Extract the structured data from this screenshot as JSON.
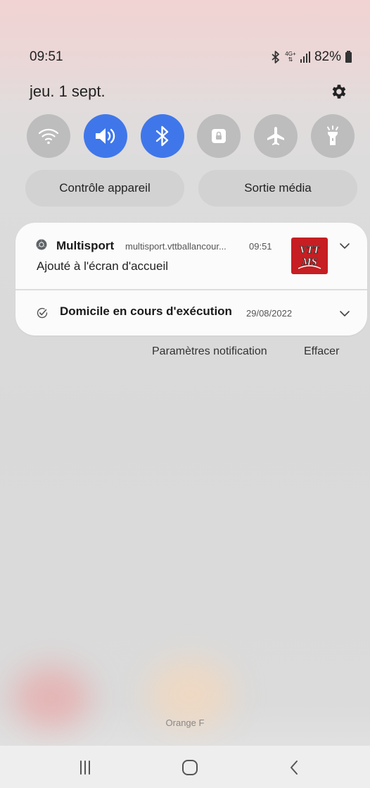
{
  "status_bar": {
    "time": "09:51",
    "network": "4G+",
    "battery": "82%",
    "icons": [
      "bluetooth-icon",
      "network-4g-icon",
      "signal-icon",
      "battery-icon"
    ]
  },
  "header": {
    "date": "jeu. 1 sept.",
    "settings_icon": "gear-icon"
  },
  "quick_settings": [
    {
      "name": "wifi",
      "icon": "wifi-icon",
      "active": false
    },
    {
      "name": "sound",
      "icon": "speaker-icon",
      "active": true
    },
    {
      "name": "bluetooth",
      "icon": "bluetooth-icon",
      "active": true
    },
    {
      "name": "rotation-lock",
      "icon": "lock-icon",
      "active": false
    },
    {
      "name": "airplane-mode",
      "icon": "airplane-icon",
      "active": false
    },
    {
      "name": "flashlight",
      "icon": "flashlight-icon",
      "active": false
    }
  ],
  "buttons": {
    "device_control": "Contrôle appareil",
    "media_output": "Sortie média"
  },
  "notifications": [
    {
      "app": "Multisport",
      "source": "multisport.vttballancour...",
      "time": "09:51",
      "body": "Ajouté à l'écran d'accueil",
      "icon": "chrome-icon",
      "thumbnail_text": "VTT MS"
    },
    {
      "title": "Domicile en cours d'exécution",
      "date": "29/08/2022",
      "icon": "check-circle-icon"
    }
  ],
  "notification_actions": {
    "settings": "Paramètres notification",
    "clear": "Effacer"
  },
  "carrier": "Orange F",
  "nav": [
    "recent-apps-icon",
    "home-icon",
    "back-icon"
  ],
  "colors": {
    "accent": "#3f77ea",
    "tile_inactive": "#bdbdbd",
    "card": "#fbfbfb",
    "thumbnail_bg": "#c61e22"
  }
}
